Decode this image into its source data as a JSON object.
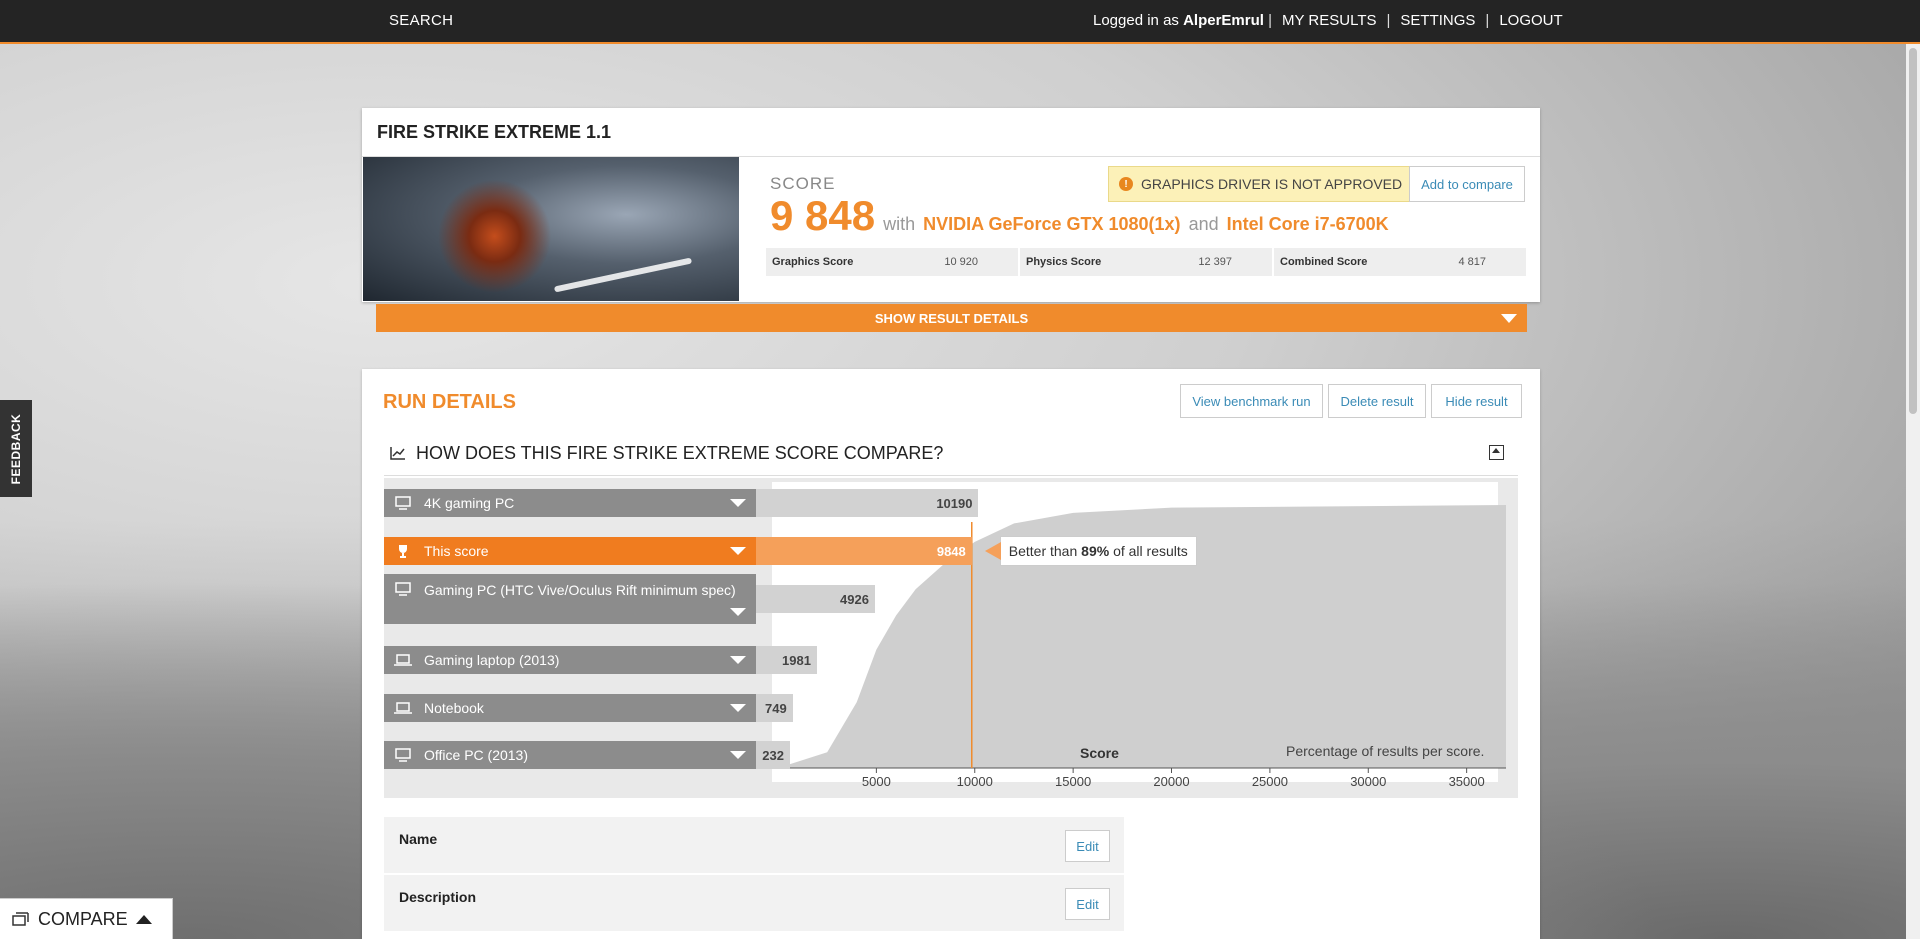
{
  "nav": {
    "search": "SEARCH",
    "logged_in_prefix": "Logged in as",
    "username": "AlperEmrul",
    "sep": "|",
    "my_results": "MY RESULTS",
    "settings": "SETTINGS",
    "logout": "LOGOUT"
  },
  "result": {
    "title": "FIRE STRIKE EXTREME 1.1",
    "score_label": "SCORE",
    "score": "9 848",
    "with": "with",
    "gpu": "NVIDIA GeForce GTX 1080(1x)",
    "and": "and",
    "cpu": "Intel Core i7-6700K",
    "driver_warning": "GRAPHICS DRIVER IS NOT APPROVED",
    "add_compare": "Add to compare",
    "subscores": [
      {
        "name": "Graphics Score",
        "value": "10 920"
      },
      {
        "name": "Physics Score",
        "value": "12 397"
      },
      {
        "name": "Combined Score",
        "value": "4 817"
      }
    ],
    "show_details": "SHOW RESULT DETAILS"
  },
  "run": {
    "heading": "RUN DETAILS",
    "view_run": "View benchmark run",
    "delete": "Delete result",
    "hide": "Hide result",
    "compare_title": "HOW DOES THIS FIRE STRIKE EXTREME SCORE COMPARE?",
    "tooltip_prefix": "Better than",
    "tooltip_pct": "89%",
    "tooltip_suffix": "of all results",
    "fields": [
      {
        "label": "Name",
        "edit": "Edit"
      },
      {
        "label": "Description",
        "edit": "Edit"
      }
    ]
  },
  "chart_data": {
    "type": "area",
    "title": "HOW DOES THIS FIRE STRIKE EXTREME SCORE COMPARE?",
    "xlabel": "Score",
    "ylabel": "Percentage of results per score.",
    "xlim": [
      0,
      37000
    ],
    "x_ticks": [
      5000,
      10000,
      15000,
      20000,
      25000,
      30000,
      35000
    ],
    "current_score": 9848,
    "percentile": 89,
    "curve": [
      {
        "x": 0,
        "y": 0
      },
      {
        "x": 2500,
        "y": 0.06
      },
      {
        "x": 4000,
        "y": 0.25
      },
      {
        "x": 5000,
        "y": 0.45
      },
      {
        "x": 6000,
        "y": 0.58
      },
      {
        "x": 7000,
        "y": 0.68
      },
      {
        "x": 8500,
        "y": 0.78
      },
      {
        "x": 10000,
        "y": 0.86
      },
      {
        "x": 12000,
        "y": 0.93
      },
      {
        "x": 15000,
        "y": 0.97
      },
      {
        "x": 20000,
        "y": 0.99
      },
      {
        "x": 37000,
        "y": 1.0
      }
    ],
    "references": [
      {
        "name": "4K gaming PC",
        "score": 10190,
        "current": false,
        "icon": "desktop-icon"
      },
      {
        "name": "This score",
        "score": 9848,
        "current": true,
        "icon": "trophy-icon"
      },
      {
        "name": "Gaming PC (HTC Vive/Oculus Rift minimum spec)",
        "score": 4926,
        "current": false,
        "icon": "desktop-icon"
      },
      {
        "name": "Gaming laptop (2013)",
        "score": 1981,
        "current": false,
        "icon": "laptop-icon"
      },
      {
        "name": "Notebook",
        "score": 749,
        "current": false,
        "icon": "laptop-icon"
      },
      {
        "name": "Office PC (2013)",
        "score": 232,
        "current": false,
        "icon": "desktop-icon"
      }
    ],
    "colors": {
      "accent": "#f08b2c",
      "bar": "#8c8c8c",
      "area": "#cfcfcf"
    }
  },
  "side": {
    "feedback": "FEEDBACK",
    "compare": "COMPARE"
  }
}
